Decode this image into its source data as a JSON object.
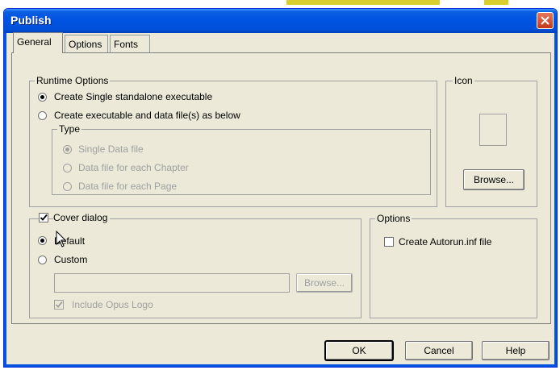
{
  "window": {
    "title": "Publish"
  },
  "tabs": [
    {
      "label": "General",
      "active": true
    },
    {
      "label": "Options",
      "active": false
    },
    {
      "label": "Fonts",
      "active": false
    }
  ],
  "runtime": {
    "legend": "Runtime Options",
    "opt_single": "Create Single standalone executable",
    "opt_multi": "Create executable and data file(s) as below",
    "type": {
      "legend": "Type",
      "opt_single_data": "Single Data file",
      "opt_chapter": "Data file for each Chapter",
      "opt_page": "Data file for each Page"
    }
  },
  "icon_group": {
    "legend": "Icon",
    "browse_label": "Browse..."
  },
  "cover": {
    "legend": "Cover dialog",
    "checked": true,
    "opt_default": "Default",
    "opt_custom": "Custom",
    "path_value": "",
    "browse_label": "Browse...",
    "include_logo": "Include Opus Logo"
  },
  "options_group": {
    "legend": "Options",
    "autorun": "Create Autorun.inf file"
  },
  "footer": {
    "ok_label": "OK",
    "cancel_label": "Cancel",
    "help_label": "Help"
  },
  "colors": {
    "title_bar": "#0054e3",
    "dialog_bg": "#ece9d8",
    "close_button": "#c1381a"
  }
}
